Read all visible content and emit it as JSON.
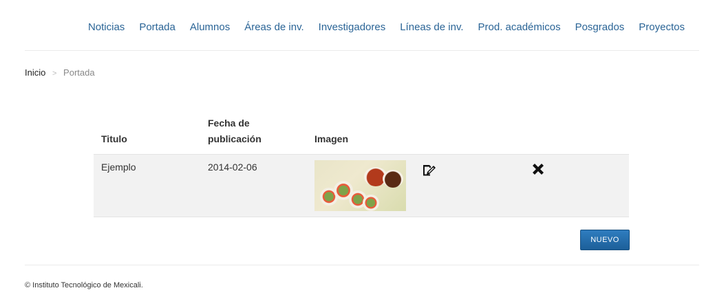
{
  "nav": {
    "items": [
      {
        "label": "Noticias"
      },
      {
        "label": "Portada"
      },
      {
        "label": "Alumnos"
      },
      {
        "label": "Áreas de inv."
      },
      {
        "label": "Investigadores"
      },
      {
        "label": "Líneas de inv."
      },
      {
        "label": "Prod. académicos"
      },
      {
        "label": "Posgrados"
      },
      {
        "label": "Proyectos"
      }
    ],
    "link_color": "#2a6496"
  },
  "breadcrumb": {
    "home": "Inicio",
    "separator": ">",
    "current": "Portada"
  },
  "table": {
    "headers": {
      "title": "Titulo",
      "date_line1": "Fecha de",
      "date_line2": "publicación",
      "image": "Imagen"
    },
    "rows": [
      {
        "title": "Ejemplo",
        "date": "2014-02-06",
        "image_icon": "food-thumbnail",
        "edit_icon": "edit-icon",
        "delete_icon": "delete-icon"
      }
    ]
  },
  "actions": {
    "new_label": "NUEVO",
    "button_color": "#1f6aa8"
  },
  "footer": {
    "copyright": "© Instituto Tecnológico de Mexicali."
  }
}
